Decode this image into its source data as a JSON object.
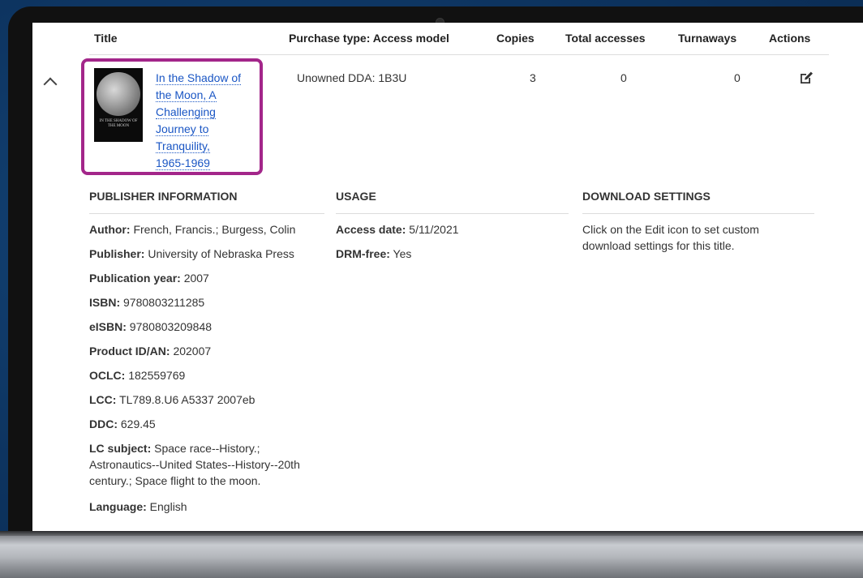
{
  "table": {
    "headers": {
      "title": "Title",
      "purchase_type": "Purchase type: Access model",
      "copies": "Copies",
      "total_accesses": "Total accesses",
      "turnaways": "Turnaways",
      "actions": "Actions"
    },
    "row": {
      "title_lines": [
        "In the Shadow of",
        "the Moon, A",
        "Challenging",
        "Journey to",
        "Tranquility,",
        "1965-1969"
      ],
      "cover_text": "IN THE SHADOW OF THE MOON",
      "purchase_type": "Unowned DDA: 1B3U",
      "copies": "3",
      "total_accesses": "0",
      "turnaways": "0"
    }
  },
  "sections": {
    "publisher_heading": "PUBLISHER INFORMATION",
    "usage_heading": "USAGE",
    "download_heading": "DOWNLOAD SETTINGS"
  },
  "publisher": {
    "author_label": "Author:",
    "author": "French, Francis.; Burgess, Colin",
    "publisher_label": "Publisher:",
    "publisher": "University of Nebraska Press",
    "year_label": "Publication year:",
    "year": "2007",
    "isbn_label": "ISBN:",
    "isbn": "9780803211285",
    "eisbn_label": "eISBN:",
    "eisbn": "9780803209848",
    "product_label": "Product ID/AN:",
    "product": "202007",
    "oclc_label": "OCLC:",
    "oclc": "182559769",
    "lcc_label": "LCC:",
    "lcc": "TL789.8.U6 A5337 2007eb",
    "ddc_label": "DDC:",
    "ddc": "629.45",
    "lc_subject_label": "LC subject:",
    "lc_subject_lines": [
      "Space race--History.;",
      "Astronautics--United States--History--20th",
      "century.; Space flight to the moon."
    ],
    "language_label": "Language:",
    "language": "English"
  },
  "usage": {
    "access_date_label": "Access date:",
    "access_date": "5/11/2021",
    "drm_label": "DRM-free:",
    "drm": "Yes"
  },
  "download": {
    "lines": [
      "Click on the Edit icon to set custom",
      "download settings for this title."
    ]
  },
  "icons": {
    "expand": "chevron-up-icon",
    "edit": "edit-icon"
  },
  "colors": {
    "link": "#1a56c4",
    "highlight": "#a3268a"
  }
}
